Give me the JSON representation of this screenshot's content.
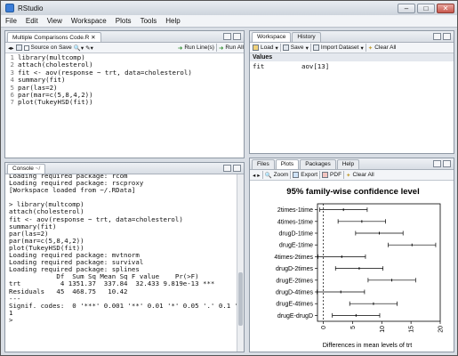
{
  "window": {
    "title": "RStudio"
  },
  "menu": [
    "File",
    "Edit",
    "View",
    "Workspace",
    "Plots",
    "Tools",
    "Help"
  ],
  "editor": {
    "tab": "Multiple Comparisons Code.R",
    "source_on_save": "Source on Save",
    "run_lines": "Run Line(s)",
    "run_all": "Run All",
    "lines": [
      "library(multcomp)",
      "attach(cholesterol)",
      "fit <- aov(response ~ trt, data=cholesterol)",
      "summary(fit)",
      "par(las=2)",
      "par(mar=c(5,8,4,2))",
      "plot(TukeyHSD(fit))"
    ]
  },
  "workspace": {
    "tabs": [
      "Workspace",
      "History"
    ],
    "load": "Load",
    "save": "Save",
    "import": "Import Dataset",
    "clear": "Clear All",
    "section": "Values",
    "rows": [
      {
        "name": "fit",
        "value": "aov[13]"
      }
    ]
  },
  "console": {
    "tab": "Console",
    "lines": [
      "Loading required package: rcom",
      "Loading required package: rscproxy",
      "[Workspace loaded from ~/.RData]",
      "",
      "> library(multcomp)",
      "attach(cholesterol)",
      "fit <- aov(response ~ trt, data=cholesterol)",
      "summary(fit)",
      "par(las=2)",
      "par(mar=c(5,8,4,2))",
      "plot(TukeyHSD(fit))",
      "Loading required package: mvtnorm",
      "Loading required package: survival",
      "Loading required package: splines",
      "            Df  Sum Sq Mean Sq F value    Pr(>F)",
      "trt          4 1351.37  337.84  32.433 9.819e-13 ***",
      "Residuals   45  468.75   10.42",
      "---",
      "Signif. codes:  0 '***' 0.001 '**' 0.01 '*' 0.05 '.' 0.1 ' ' 1",
      "1",
      ">"
    ]
  },
  "plots": {
    "tabs": [
      "Files",
      "Plots",
      "Packages",
      "Help"
    ],
    "zoom": "Zoom",
    "export": "Export",
    "pdf": "PDF",
    "clear": "Clear All"
  },
  "chart_data": {
    "type": "scatter",
    "title": "95% family-wise confidence level",
    "xlabel": "Differences in mean levels of trt",
    "ylabel": "",
    "xlim": [
      -1,
      20
    ],
    "xticks": [
      0,
      5,
      10,
      15,
      20
    ],
    "categories": [
      "2times-1time",
      "4times-1time",
      "drugD-1time",
      "drugE-1time",
      "4times-2times",
      "drugD-2times",
      "drugE-2times",
      "drugD-4times",
      "drugE-4times",
      "drugE-drugD"
    ],
    "series": [
      {
        "estimate": [
          3.44,
          6.59,
          9.58,
          15.17,
          3.15,
          6.14,
          11.72,
          2.99,
          8.58,
          5.59
        ],
        "lower": [
          -0.62,
          2.52,
          5.52,
          11.1,
          -0.91,
          2.08,
          7.66,
          -1.07,
          4.51,
          1.53
        ],
        "upper": [
          7.51,
          10.65,
          13.64,
          19.23,
          7.21,
          10.2,
          15.79,
          7.05,
          12.64,
          9.65
        ]
      }
    ],
    "reference_line": 0
  }
}
